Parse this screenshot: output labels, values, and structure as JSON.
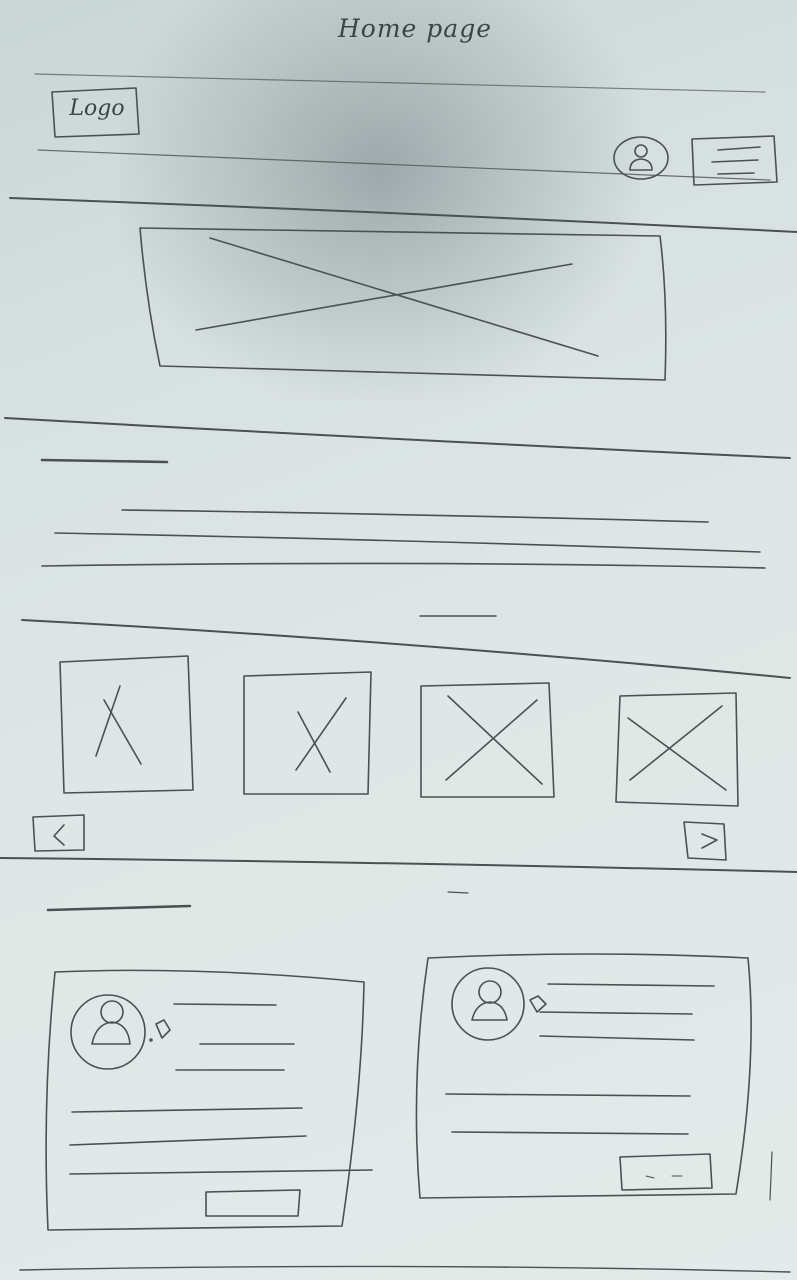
{
  "page_title": "Home page",
  "header": {
    "logo_text": "Logo",
    "profile_icon": "user-icon",
    "menu_icon": "hamburger-icon"
  },
  "carousel": {
    "prev_icon": "chevron-left-icon",
    "next_icon": "chevron-right-icon"
  },
  "colors": {
    "paper": "#dfe7e6",
    "pencil": "#4a5153"
  }
}
